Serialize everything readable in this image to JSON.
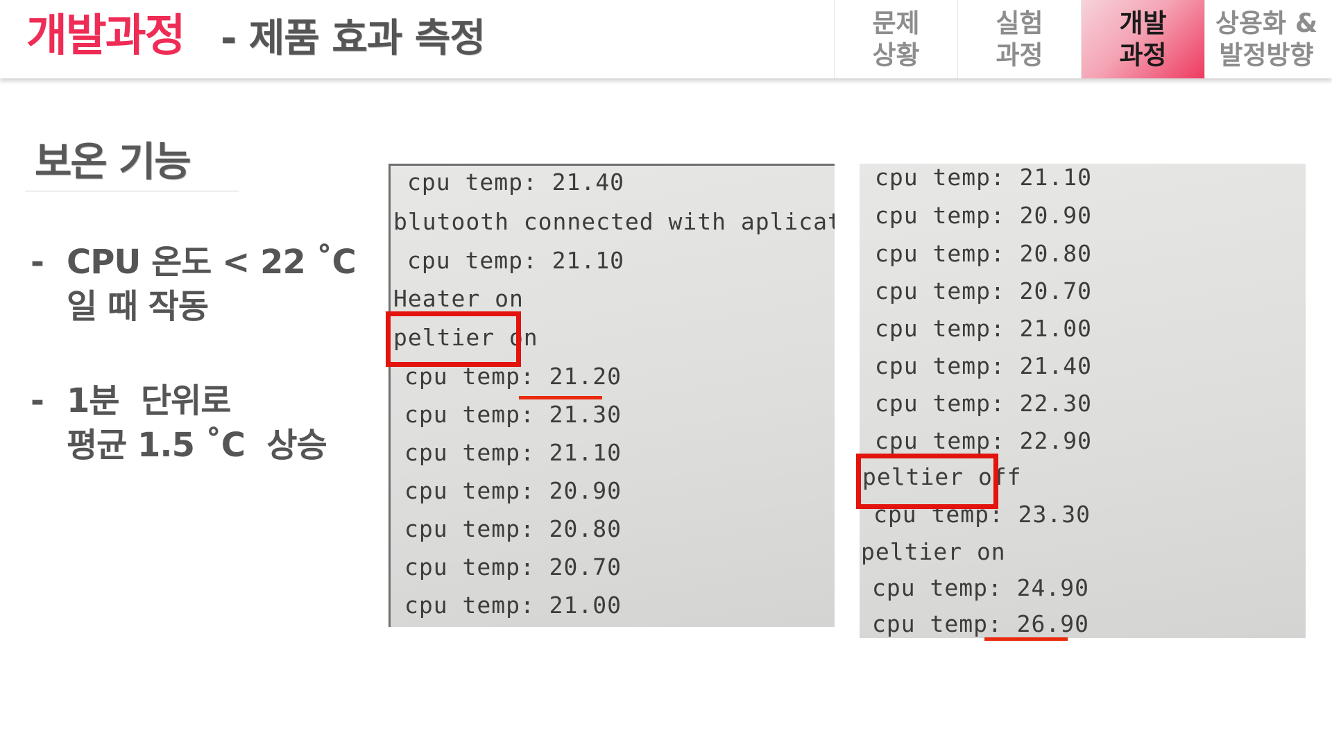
{
  "header": {
    "title": "개발과정",
    "subtitle": "- 제품 효과 측정",
    "tabs": [
      {
        "label": "문제\n상황",
        "active": false
      },
      {
        "label": "실험\n과정",
        "active": false
      },
      {
        "label": "개발\n과정",
        "active": true
      },
      {
        "label": "상용화 &\n발정방향",
        "active": false
      }
    ],
    "accent_color": "#ee2c55"
  },
  "section": {
    "title": "보온 기능",
    "bullets": [
      {
        "dash": "-",
        "text": "CPU 온도 < 22 ˚C\n일 때 작동"
      },
      {
        "dash": "-",
        "text": "1분  단위로\n평균 1.5 ˚C  상승"
      }
    ]
  },
  "photo_left": {
    "lines": [
      "cpu temp: 21.40",
      "blutooth connected with aplication",
      "cpu temp: 21.10",
      "Heater on",
      "peltier on",
      "cpu temp: 21.20",
      "cpu temp: 21.30",
      "cpu temp: 21.10",
      "cpu temp: 20.90",
      "cpu temp: 20.80",
      "cpu temp: 20.70",
      "cpu temp: 21.00"
    ],
    "boxed_line": "peltier on",
    "underlined_value": "21.20"
  },
  "photo_right": {
    "lines": [
      "cpu temp: 21.10",
      "cpu temp: 20.90",
      "cpu temp: 20.80",
      "cpu temp: 20.70",
      "cpu temp: 21.00",
      "cpu temp: 21.40",
      "cpu temp: 22.30",
      "cpu temp: 22.90",
      "peltier off",
      "cpu temp: 23.30",
      "peltier on",
      "cpu temp: 24.90",
      "cpu temp: 26.90"
    ],
    "boxed_line": "peltier off",
    "underlined_value": "26.90"
  },
  "colors": {
    "highlight_box": "#e3130d",
    "underline": "#ea2a0e",
    "active_tab": "#ee3a60"
  }
}
